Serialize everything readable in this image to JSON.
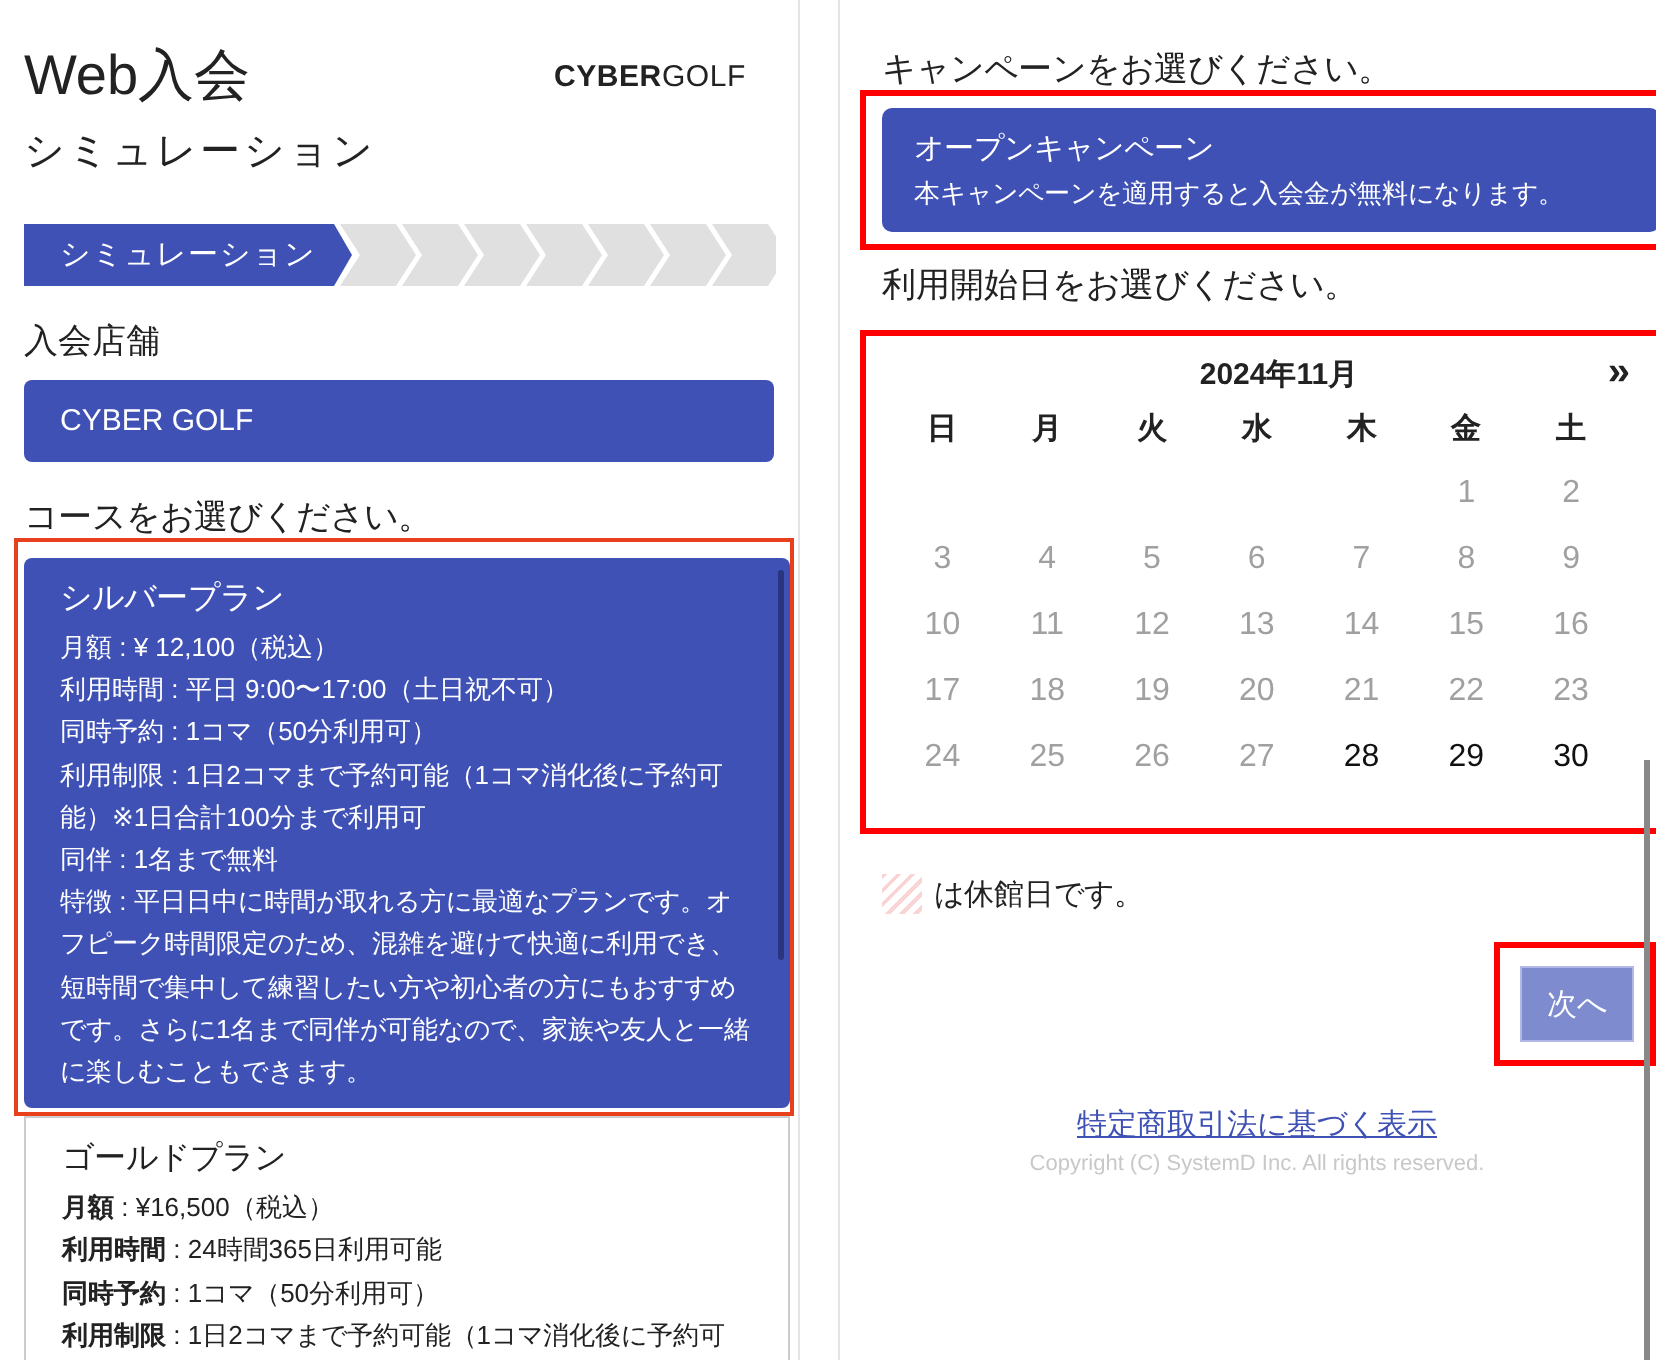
{
  "left": {
    "title": "Web入会",
    "logo": {
      "bold": "CYBER",
      "light": "GOLF"
    },
    "subtitle": "シミュレーション",
    "steps": [
      {
        "label": "シミュレーション",
        "selected": true
      },
      {
        "selected": false
      },
      {
        "selected": false
      },
      {
        "selected": false
      },
      {
        "selected": false
      },
      {
        "selected": false
      },
      {
        "selected": false
      },
      {
        "selected": false
      }
    ],
    "store_label": "入会店舗",
    "store": "CYBER GOLF",
    "course_prompt": "コースをお選びください。",
    "plans": [
      {
        "name": "シルバープラン",
        "selected": true,
        "highlighted": true,
        "lines": [
          "月額 : ¥ 12,100（税込）",
          "利用時間 : 平日 9:00〜17:00（土日祝不可）",
          "同時予約 : 1コマ（50分利用可）",
          "利用制限 : 1日2コマまで予約可能（1コマ消化後に予約可能）※1日合計100分まで利用可",
          "同伴 : 1名まで無料",
          "特徴 : 平日日中に時間が取れる方に最適なプランです。オフピーク時間限定のため、混雑を避けて快適に利用でき、短時間で集中して練習したい方や初心者の方にもおすすめです。さらに1名まで同伴が可能なので、家族や友人と一緒に楽しむこともできます。"
        ]
      },
      {
        "name": "ゴールドプラン",
        "selected": false,
        "highlighted": false,
        "lines": [
          "**月額** : ¥16,500（税込）",
          "**利用時間** : 24時間365日利用可能",
          "**同時予約** : 1コマ（50分利用可）",
          "**利用制限** : 1日2コマまで予約可能（1コマ消化後に予約可"
        ]
      }
    ]
  },
  "right": {
    "campaign_prompt": "キャンペーンをお選びください。",
    "campaign": {
      "title": "オープンキャンペーン",
      "description": "本キャンペーンを適用すると入会金が無料になります。",
      "selected": true,
      "highlighted": true
    },
    "date_prompt": "利用開始日をお選びください。",
    "calendar": {
      "month": "2024年11月",
      "next": "»",
      "highlighted": true,
      "weekdays": [
        "日",
        "月",
        "火",
        "水",
        "木",
        "金",
        "土"
      ],
      "days": [
        {
          "day": "1",
          "disabled": true
        },
        {
          "day": "2",
          "disabled": true
        },
        {
          "day": "3",
          "disabled": true
        },
        {
          "day": "4",
          "disabled": true
        },
        {
          "day": "5",
          "disabled": true
        },
        {
          "day": "6",
          "disabled": true
        },
        {
          "day": "7",
          "disabled": true
        },
        {
          "day": "8",
          "disabled": true
        },
        {
          "day": "9",
          "disabled": true
        },
        {
          "day": "10",
          "disabled": true
        },
        {
          "day": "11",
          "disabled": true
        },
        {
          "day": "12",
          "disabled": true
        },
        {
          "day": "13",
          "disabled": true
        },
        {
          "day": "14",
          "disabled": true
        },
        {
          "day": "15",
          "disabled": true
        },
        {
          "day": "16",
          "disabled": true
        },
        {
          "day": "17",
          "disabled": true
        },
        {
          "day": "18",
          "disabled": true
        },
        {
          "day": "19",
          "disabled": true
        },
        {
          "day": "20",
          "disabled": true
        },
        {
          "day": "21",
          "disabled": true
        },
        {
          "day": "22",
          "disabled": true
        },
        {
          "day": "23",
          "disabled": true
        },
        {
          "day": "24",
          "disabled": true
        },
        {
          "day": "25",
          "disabled": true
        },
        {
          "day": "26",
          "disabled": true
        },
        {
          "day": "27",
          "disabled": true
        },
        {
          "day": "28",
          "disabled": false
        },
        {
          "day": "29",
          "disabled": false
        },
        {
          "day": "30",
          "disabled": false
        }
      ]
    },
    "legend": "は休館日です。",
    "next_button": {
      "label": "次へ",
      "disabled": true,
      "highlighted": true
    },
    "footer_link": "特定商取引法に基づく表示",
    "copyright": "Copyright (C) SystemD Inc. All rights reserved."
  }
}
